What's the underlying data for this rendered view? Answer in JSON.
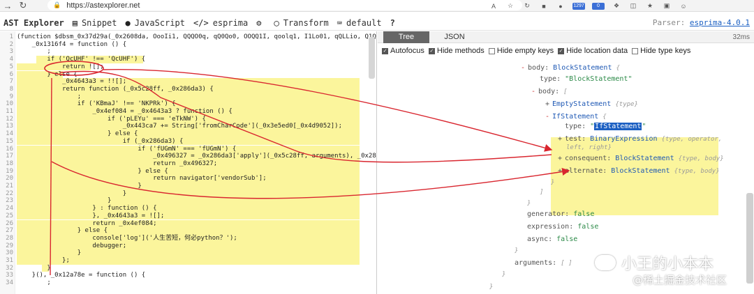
{
  "browser": {
    "url": "https://astexplorer.net",
    "badge_count": "1297",
    "badge2": "0"
  },
  "toolbar": {
    "brand": "AST Explorer",
    "snippet": "Snippet",
    "language": "JavaScript",
    "parser_name": "esprima",
    "transform": "Transform",
    "transform_value": "default",
    "help": "?",
    "parser_label": "Parser:",
    "parser_version": "esprima-4.0.1"
  },
  "panel": {
    "tab_tree": "Tree",
    "tab_json": "JSON",
    "elapsed": "32ms",
    "options": [
      {
        "label": "Autofocus",
        "checked": true
      },
      {
        "label": "Hide methods",
        "checked": true
      },
      {
        "label": "Hide empty keys",
        "checked": false
      },
      {
        "label": "Hide location data",
        "checked": true
      },
      {
        "label": "Hide type keys",
        "checked": false
      }
    ]
  },
  "code_lines": [
    "(function $dbsm_0x37d29a(_0x2608da, OooIi1, QQQO0q, qQ0Qo0, OOQQ1I, qoolq1, I1Lo01, qQLLio, Q1Qq",
    "    _0x1316f4 = function () {",
    "        ;",
    "        if ('QcUHF' !== 'QcUHF') {",
    "            return ![];",
    "        } else {",
    "            _0x4643a3 = !![];",
    "            return function (_0x5c28ff, _0x286da3) {",
    "                ;",
    "                if ('KBmaJ' !== 'NKPRk') {",
    "                    _0x4ef084 = _0x4643a3 ? function () {",
    "                        if ('pLEYu' === 'eTkNW') {",
    "                            _0x443ca7 += String['fromCharCode'](_0x3e5ed0[_0x4d9052]);",
    "                        } else {",
    "                            if (_0x286da3) {",
    "                                if ('fUGmN' === 'fUGmN') {",
    "                                    _0x496327 = _0x286da3['apply'](_0x5c28ff, arguments), _0x286",
    "                                    return _0x496327;",
    "                                } else {",
    "                                    return navigator['vendorSub'];",
    "                                }",
    "                            }",
    "                        }",
    "                    } : function () {",
    "                    }, _0x4643a3 = ![];",
    "                    return _0x4ef084;",
    "                } else {",
    "                    console['log']('人生苦短，何必python？');",
    "                    debugger;",
    "                }",
    "            };",
    "        }",
    "    }(), _0x12a78e = function () {",
    "        ;"
  ],
  "line_numbers": [
    "1",
    "2",
    "3",
    "4",
    "5",
    "6",
    "7",
    "8",
    "9",
    "10",
    "11",
    "12",
    "13",
    "14",
    "15",
    "16",
    "17",
    "18",
    "19",
    "20",
    "21",
    "22",
    "23",
    "24",
    "25",
    "26",
    "27",
    "28",
    "29",
    "30",
    "31",
    "32",
    "33",
    "34"
  ],
  "tree": {
    "body_key": "body:",
    "body_type": "BlockStatement",
    "type_key": "type:",
    "type_val": "\"BlockStatement\"",
    "body2_key": "body:",
    "empty_stmt": "EmptyStatement",
    "empty_meta": "{type}",
    "if_stmt": "IfStatement",
    "if_type_key": "type:",
    "if_type_val": "IfStatement",
    "test_key": "test:",
    "test_val": "BinaryExpression",
    "test_meta1": "{type, operator,",
    "test_meta2": "left, right}",
    "consequent_key": "consequent:",
    "consequent_val": "BlockStatement",
    "consequent_meta": "{type, body}",
    "alternate_key": "alternate:",
    "alternate_val": "BlockStatement",
    "alternate_meta": "{type, body}",
    "generator_key": "generator:",
    "generator_val": "false",
    "expression_key": "expression:",
    "expression_val": "false",
    "async_key": "async:",
    "async_val": "false",
    "arguments_key": "arguments:",
    "arguments_val": "[ ]"
  },
  "watermark": {
    "line1": "小王的小本本",
    "line2": "@稀土掘金技术社区"
  },
  "colors": {
    "highlight": "#fbf59c",
    "arrow": "#d9262f",
    "type": "#1e58b4",
    "selection": "#1b5fc2"
  }
}
